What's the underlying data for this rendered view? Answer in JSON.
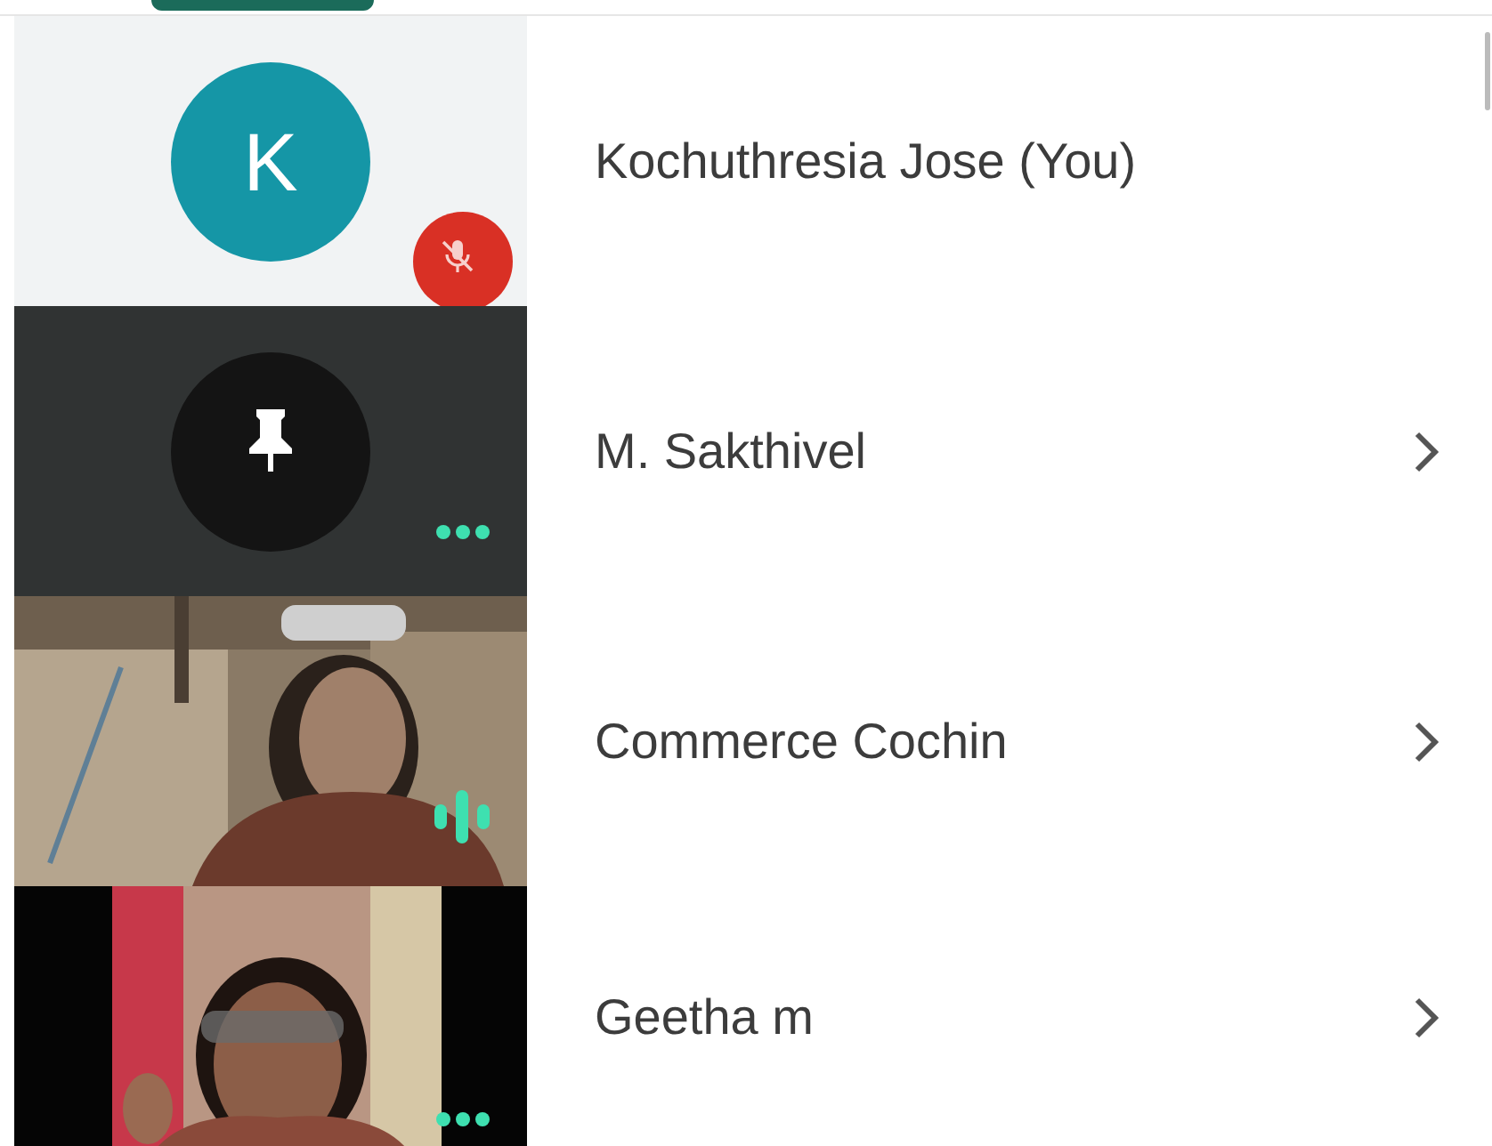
{
  "participants": [
    {
      "name": "Kochuthresia Jose (You)",
      "kind": "avatar",
      "initial": "K",
      "color": "#1596a6",
      "indicator": {
        "kind": "muted"
      },
      "chevron": false
    },
    {
      "name": "M. Sakthivel",
      "kind": "pinned",
      "color": "#141414",
      "indicator": {
        "kind": "idle"
      },
      "chevron": true
    },
    {
      "name": "Commerce Cochin",
      "kind": "video",
      "indicator": {
        "kind": "speaking"
      },
      "chevron": true
    },
    {
      "name": "Geetha m",
      "kind": "video",
      "indicator": {
        "kind": "idle"
      },
      "chevron": true
    }
  ]
}
